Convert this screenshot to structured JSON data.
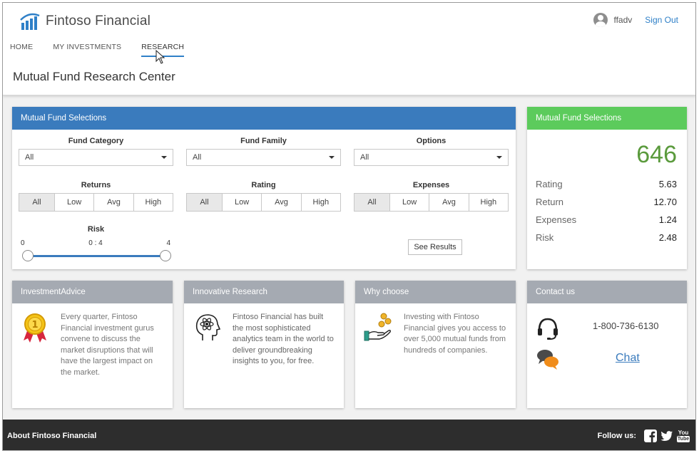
{
  "header": {
    "brand": "Fintoso Financial",
    "username": "ffadv",
    "signout": "Sign Out",
    "nav": [
      {
        "label": "HOME"
      },
      {
        "label": "MY INVESTMENTS"
      },
      {
        "label": "RESEARCH",
        "active": true
      }
    ],
    "page_title": "Mutual Fund Research Center"
  },
  "selections": {
    "title": "Mutual Fund Selections",
    "fund_category": {
      "label": "Fund Category",
      "value": "All"
    },
    "fund_family": {
      "label": "Fund Family",
      "value": "All"
    },
    "options": {
      "label": "Options",
      "value": "All"
    },
    "returns": {
      "label": "Returns",
      "choices": [
        "All",
        "Low",
        "Avg",
        "High"
      ]
    },
    "rating": {
      "label": "Rating",
      "choices": [
        "All",
        "Low",
        "Avg",
        "High"
      ]
    },
    "expenses": {
      "label": "Expenses",
      "choices": [
        "All",
        "Low",
        "Avg",
        "High"
      ]
    },
    "risk": {
      "label": "Risk",
      "min": "0",
      "range": "0 : 4",
      "max": "4"
    },
    "see_results": "See Results"
  },
  "summary": {
    "title": "Mutual Fund Selections",
    "count": "646",
    "stats": [
      {
        "label": "Rating",
        "value": "5.63"
      },
      {
        "label": "Return",
        "value": "12.70"
      },
      {
        "label": "Expenses",
        "value": "1.24"
      },
      {
        "label": "Risk",
        "value": "2.48"
      }
    ]
  },
  "cards": {
    "advice": {
      "title": "InvestmentAdvice",
      "text": "Every quarter, Fintoso Financial investment gurus convene to discuss the market disruptions that will have the largest impact on the market."
    },
    "research": {
      "title": "Innovative Research",
      "text": "Fintoso Financial has built the most sophisticated analytics team in the world to deliver groundbreaking insights to you, for free."
    },
    "why": {
      "title": "Why choose",
      "text": "Investing with Fintoso Financial gives you access to over 5,000 mutual funds from hundreds of companies."
    },
    "contact": {
      "title": "Contact us",
      "phone": "1-800-736-6130",
      "chat": "Chat"
    }
  },
  "footer": {
    "about": "About Fintoso Financial",
    "follow": "Follow us:",
    "youtube_top": "You",
    "youtube_bottom": "Tube"
  },
  "colors": {
    "primary_blue": "#3a7bbd",
    "green": "#5ccb5c",
    "count_green": "#5a9a3c",
    "card_header_gray": "#a5aab2",
    "footer_dark": "#2d2d2d"
  },
  "icons": [
    "fintoso-logo-icon",
    "user-avatar-icon",
    "caret-down-icon",
    "medal-icon",
    "atom-head-icon",
    "hand-coins-icon",
    "headset-icon",
    "chat-bubbles-icon",
    "facebook-icon",
    "twitter-icon",
    "youtube-icon"
  ]
}
